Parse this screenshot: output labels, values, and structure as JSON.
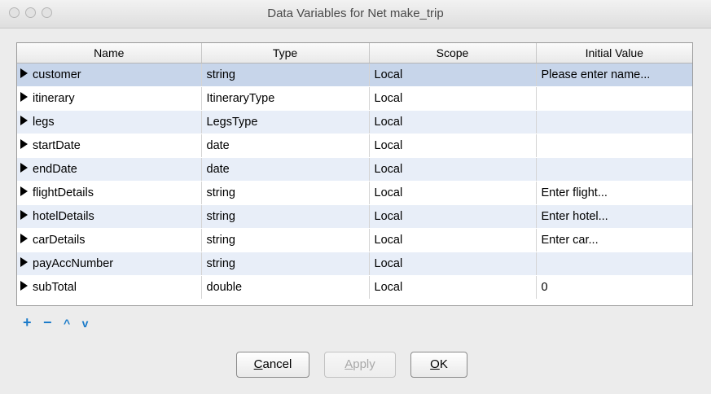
{
  "window": {
    "title": "Data Variables for  Net make_trip"
  },
  "table": {
    "headers": [
      "Name",
      "Type",
      "Scope",
      "Initial Value"
    ],
    "rows": [
      {
        "name": "customer",
        "type": "string",
        "scope": "Local",
        "initial": "Please enter name..."
      },
      {
        "name": "itinerary",
        "type": "ItineraryType",
        "scope": "Local",
        "initial": ""
      },
      {
        "name": "legs",
        "type": "LegsType",
        "scope": "Local",
        "initial": ""
      },
      {
        "name": "startDate",
        "type": "date",
        "scope": "Local",
        "initial": ""
      },
      {
        "name": "endDate",
        "type": "date",
        "scope": "Local",
        "initial": ""
      },
      {
        "name": "flightDetails",
        "type": "string",
        "scope": "Local",
        "initial": "Enter flight..."
      },
      {
        "name": "hotelDetails",
        "type": "string",
        "scope": "Local",
        "initial": "Enter hotel..."
      },
      {
        "name": "carDetails",
        "type": "string",
        "scope": "Local",
        "initial": "Enter car..."
      },
      {
        "name": "payAccNumber",
        "type": "string",
        "scope": "Local",
        "initial": ""
      },
      {
        "name": "subTotal",
        "type": "double",
        "scope": "Local",
        "initial": "0"
      }
    ]
  },
  "toolbar": {
    "add": "+",
    "remove": "−",
    "up": "^",
    "down": "v"
  },
  "buttons": {
    "cancel": {
      "mnemonic": "C",
      "rest": "ancel"
    },
    "apply": {
      "mnemonic": "A",
      "rest": "pply"
    },
    "ok": {
      "mnemonic": "O",
      "rest": "K"
    }
  }
}
